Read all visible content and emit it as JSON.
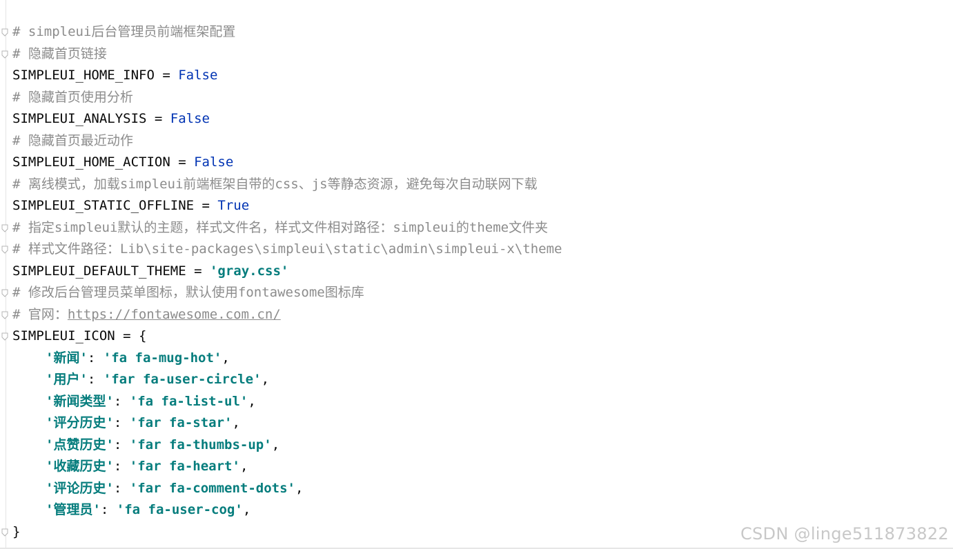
{
  "editor": {
    "lines": [
      {
        "fold": true,
        "parts": [
          {
            "t": "comment",
            "v": "# simpleui后台管理员前端框架配置"
          }
        ]
      },
      {
        "fold": true,
        "parts": [
          {
            "t": "comment",
            "v": "# 隐藏首页链接"
          }
        ]
      },
      {
        "fold": false,
        "parts": [
          {
            "t": "punct",
            "v": "SIMPLEUI_HOME_INFO = "
          },
          {
            "t": "kw",
            "v": "False"
          }
        ]
      },
      {
        "fold": false,
        "parts": [
          {
            "t": "comment",
            "v": "# 隐藏首页使用分析"
          }
        ]
      },
      {
        "fold": false,
        "parts": [
          {
            "t": "punct",
            "v": "SIMPLEUI_ANALYSIS = "
          },
          {
            "t": "kw",
            "v": "False"
          }
        ]
      },
      {
        "fold": false,
        "parts": [
          {
            "t": "comment",
            "v": "# 隐藏首页最近动作"
          }
        ]
      },
      {
        "fold": false,
        "parts": [
          {
            "t": "punct",
            "v": "SIMPLEUI_HOME_ACTION = "
          },
          {
            "t": "kw",
            "v": "False"
          }
        ]
      },
      {
        "fold": false,
        "parts": [
          {
            "t": "comment",
            "v": "# 离线模式，加载simpleui前端框架自带的css、js等静态资源，避免每次自动联网下载"
          }
        ]
      },
      {
        "fold": false,
        "parts": [
          {
            "t": "punct",
            "v": "SIMPLEUI_STATIC_OFFLINE = "
          },
          {
            "t": "kw",
            "v": "True"
          }
        ]
      },
      {
        "fold": true,
        "parts": [
          {
            "t": "comment",
            "v": "# 指定simpleui默认的主题，样式文件名，样式文件相对路径：simpleui的theme文件夹"
          }
        ]
      },
      {
        "fold": true,
        "parts": [
          {
            "t": "comment",
            "v": "# 样式文件路径：Lib\\site-packages\\simpleui\\static\\admin\\simpleui-x\\theme"
          }
        ]
      },
      {
        "fold": false,
        "parts": [
          {
            "t": "punct",
            "v": "SIMPLEUI_DEFAULT_THEME = "
          },
          {
            "t": "str",
            "v": "'gray.css'"
          }
        ]
      },
      {
        "fold": true,
        "parts": [
          {
            "t": "comment",
            "v": "# 修改后台管理员菜单图标，默认使用fontawesome图标库"
          }
        ]
      },
      {
        "fold": true,
        "parts": [
          {
            "t": "comment",
            "v": "# 官网："
          },
          {
            "t": "link",
            "v": "https://fontawesome.com.cn/"
          }
        ]
      },
      {
        "fold": true,
        "parts": [
          {
            "t": "punct",
            "v": "SIMPLEUI_ICON = {"
          }
        ]
      },
      {
        "fold": false,
        "indent": true,
        "parts": [
          {
            "t": "str",
            "v": "'新闻'"
          },
          {
            "t": "punct",
            "v": ": "
          },
          {
            "t": "str",
            "v": "'fa fa-mug-hot'"
          },
          {
            "t": "punct",
            "v": ","
          }
        ]
      },
      {
        "fold": false,
        "indent": true,
        "parts": [
          {
            "t": "str",
            "v": "'用户'"
          },
          {
            "t": "punct",
            "v": ": "
          },
          {
            "t": "str",
            "v": "'far fa-user-circle'"
          },
          {
            "t": "punct",
            "v": ","
          }
        ]
      },
      {
        "fold": false,
        "indent": true,
        "parts": [
          {
            "t": "str",
            "v": "'新闻类型'"
          },
          {
            "t": "punct",
            "v": ": "
          },
          {
            "t": "str",
            "v": "'fa fa-list-ul'"
          },
          {
            "t": "punct",
            "v": ","
          }
        ]
      },
      {
        "fold": false,
        "indent": true,
        "parts": [
          {
            "t": "str",
            "v": "'评分历史'"
          },
          {
            "t": "punct",
            "v": ": "
          },
          {
            "t": "str",
            "v": "'far fa-star'"
          },
          {
            "t": "punct",
            "v": ","
          }
        ]
      },
      {
        "fold": false,
        "indent": true,
        "parts": [
          {
            "t": "str",
            "v": "'点赞历史'"
          },
          {
            "t": "punct",
            "v": ": "
          },
          {
            "t": "str",
            "v": "'far fa-thumbs-up'"
          },
          {
            "t": "punct",
            "v": ","
          }
        ]
      },
      {
        "fold": false,
        "indent": true,
        "parts": [
          {
            "t": "str",
            "v": "'收藏历史'"
          },
          {
            "t": "punct",
            "v": ": "
          },
          {
            "t": "str",
            "v": "'far fa-heart'"
          },
          {
            "t": "punct",
            "v": ","
          }
        ]
      },
      {
        "fold": false,
        "indent": true,
        "parts": [
          {
            "t": "str",
            "v": "'评论历史'"
          },
          {
            "t": "punct",
            "v": ": "
          },
          {
            "t": "str",
            "v": "'far fa-comment-dots'"
          },
          {
            "t": "punct",
            "v": ","
          }
        ]
      },
      {
        "fold": false,
        "indent": true,
        "parts": [
          {
            "t": "str",
            "v": "'管理员'"
          },
          {
            "t": "punct",
            "v": ": "
          },
          {
            "t": "str",
            "v": "'fa fa-user-cog'"
          },
          {
            "t": "punct",
            "v": ","
          }
        ]
      },
      {
        "fold": true,
        "parts": [
          {
            "t": "punct",
            "v": "}"
          }
        ]
      }
    ]
  },
  "watermark": {
    "text": "CSDN @linge511873822"
  },
  "colors": {
    "comment": "#8c8c8c",
    "keyword": "#0033b3",
    "string": "#067d7d",
    "text": "#080808"
  },
  "icons": {
    "fold_marker": "fold-marker-icon"
  }
}
